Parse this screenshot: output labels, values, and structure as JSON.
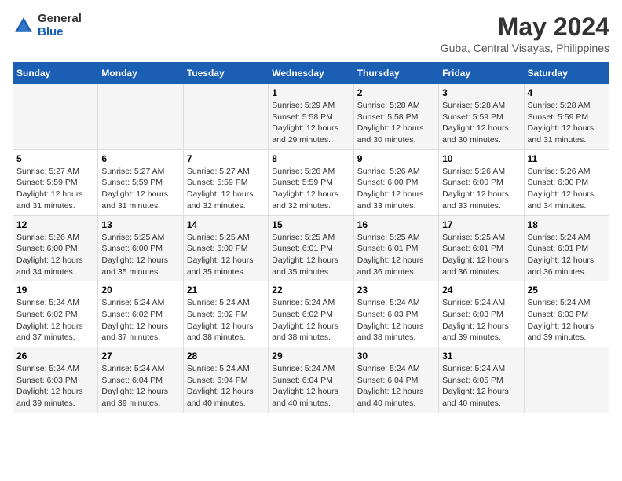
{
  "logo": {
    "general": "General",
    "blue": "Blue"
  },
  "title": "May 2024",
  "subtitle": "Guba, Central Visayas, Philippines",
  "days_of_week": [
    "Sunday",
    "Monday",
    "Tuesday",
    "Wednesday",
    "Thursday",
    "Friday",
    "Saturday"
  ],
  "weeks": [
    [
      {
        "day": "",
        "info": ""
      },
      {
        "day": "",
        "info": ""
      },
      {
        "day": "",
        "info": ""
      },
      {
        "day": "1",
        "info": "Sunrise: 5:29 AM\nSunset: 5:58 PM\nDaylight: 12 hours\nand 29 minutes."
      },
      {
        "day": "2",
        "info": "Sunrise: 5:28 AM\nSunset: 5:58 PM\nDaylight: 12 hours\nand 30 minutes."
      },
      {
        "day": "3",
        "info": "Sunrise: 5:28 AM\nSunset: 5:59 PM\nDaylight: 12 hours\nand 30 minutes."
      },
      {
        "day": "4",
        "info": "Sunrise: 5:28 AM\nSunset: 5:59 PM\nDaylight: 12 hours\nand 31 minutes."
      }
    ],
    [
      {
        "day": "5",
        "info": "Sunrise: 5:27 AM\nSunset: 5:59 PM\nDaylight: 12 hours\nand 31 minutes."
      },
      {
        "day": "6",
        "info": "Sunrise: 5:27 AM\nSunset: 5:59 PM\nDaylight: 12 hours\nand 31 minutes."
      },
      {
        "day": "7",
        "info": "Sunrise: 5:27 AM\nSunset: 5:59 PM\nDaylight: 12 hours\nand 32 minutes."
      },
      {
        "day": "8",
        "info": "Sunrise: 5:26 AM\nSunset: 5:59 PM\nDaylight: 12 hours\nand 32 minutes."
      },
      {
        "day": "9",
        "info": "Sunrise: 5:26 AM\nSunset: 6:00 PM\nDaylight: 12 hours\nand 33 minutes."
      },
      {
        "day": "10",
        "info": "Sunrise: 5:26 AM\nSunset: 6:00 PM\nDaylight: 12 hours\nand 33 minutes."
      },
      {
        "day": "11",
        "info": "Sunrise: 5:26 AM\nSunset: 6:00 PM\nDaylight: 12 hours\nand 34 minutes."
      }
    ],
    [
      {
        "day": "12",
        "info": "Sunrise: 5:26 AM\nSunset: 6:00 PM\nDaylight: 12 hours\nand 34 minutes."
      },
      {
        "day": "13",
        "info": "Sunrise: 5:25 AM\nSunset: 6:00 PM\nDaylight: 12 hours\nand 35 minutes."
      },
      {
        "day": "14",
        "info": "Sunrise: 5:25 AM\nSunset: 6:00 PM\nDaylight: 12 hours\nand 35 minutes."
      },
      {
        "day": "15",
        "info": "Sunrise: 5:25 AM\nSunset: 6:01 PM\nDaylight: 12 hours\nand 35 minutes."
      },
      {
        "day": "16",
        "info": "Sunrise: 5:25 AM\nSunset: 6:01 PM\nDaylight: 12 hours\nand 36 minutes."
      },
      {
        "day": "17",
        "info": "Sunrise: 5:25 AM\nSunset: 6:01 PM\nDaylight: 12 hours\nand 36 minutes."
      },
      {
        "day": "18",
        "info": "Sunrise: 5:24 AM\nSunset: 6:01 PM\nDaylight: 12 hours\nand 36 minutes."
      }
    ],
    [
      {
        "day": "19",
        "info": "Sunrise: 5:24 AM\nSunset: 6:02 PM\nDaylight: 12 hours\nand 37 minutes."
      },
      {
        "day": "20",
        "info": "Sunrise: 5:24 AM\nSunset: 6:02 PM\nDaylight: 12 hours\nand 37 minutes."
      },
      {
        "day": "21",
        "info": "Sunrise: 5:24 AM\nSunset: 6:02 PM\nDaylight: 12 hours\nand 38 minutes."
      },
      {
        "day": "22",
        "info": "Sunrise: 5:24 AM\nSunset: 6:02 PM\nDaylight: 12 hours\nand 38 minutes."
      },
      {
        "day": "23",
        "info": "Sunrise: 5:24 AM\nSunset: 6:03 PM\nDaylight: 12 hours\nand 38 minutes."
      },
      {
        "day": "24",
        "info": "Sunrise: 5:24 AM\nSunset: 6:03 PM\nDaylight: 12 hours\nand 39 minutes."
      },
      {
        "day": "25",
        "info": "Sunrise: 5:24 AM\nSunset: 6:03 PM\nDaylight: 12 hours\nand 39 minutes."
      }
    ],
    [
      {
        "day": "26",
        "info": "Sunrise: 5:24 AM\nSunset: 6:03 PM\nDaylight: 12 hours\nand 39 minutes."
      },
      {
        "day": "27",
        "info": "Sunrise: 5:24 AM\nSunset: 6:04 PM\nDaylight: 12 hours\nand 39 minutes."
      },
      {
        "day": "28",
        "info": "Sunrise: 5:24 AM\nSunset: 6:04 PM\nDaylight: 12 hours\nand 40 minutes."
      },
      {
        "day": "29",
        "info": "Sunrise: 5:24 AM\nSunset: 6:04 PM\nDaylight: 12 hours\nand 40 minutes."
      },
      {
        "day": "30",
        "info": "Sunrise: 5:24 AM\nSunset: 6:04 PM\nDaylight: 12 hours\nand 40 minutes."
      },
      {
        "day": "31",
        "info": "Sunrise: 5:24 AM\nSunset: 6:05 PM\nDaylight: 12 hours\nand 40 minutes."
      },
      {
        "day": "",
        "info": ""
      }
    ]
  ]
}
